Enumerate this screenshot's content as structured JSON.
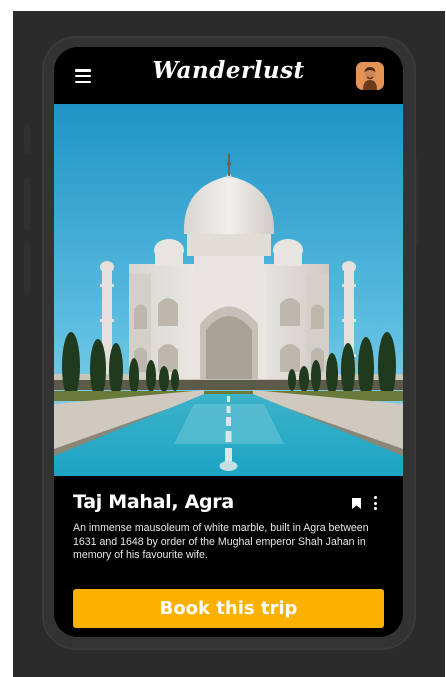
{
  "header": {
    "logo": "Wanderlust",
    "menu_icon": "hamburger-menu-icon",
    "avatar": "user-avatar"
  },
  "destination": {
    "title": "Taj Mahal, Agra",
    "description": "An immense mausoleum of white marble, built in Agra between 1631 and 1648 by order of the Mughal emperor Shah Jahan in memory of his favourite wife.",
    "actions": [
      "bookmark-icon",
      "more-vertical-icon"
    ]
  },
  "cta": {
    "label": "Book this trip"
  },
  "colors": {
    "accent": "#fcb000",
    "background": "#2b2b2b",
    "screen": "#000000"
  }
}
